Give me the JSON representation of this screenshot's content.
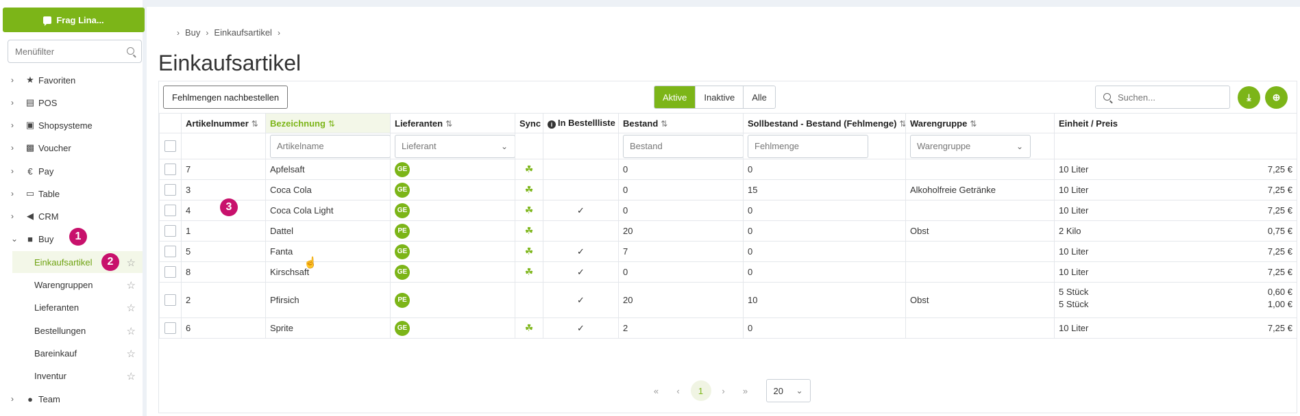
{
  "sidebar": {
    "ask_button": "Frag Lina...",
    "filter_placeholder": "Menüfilter",
    "items": [
      {
        "label": "Favoriten",
        "icon": "star-icon"
      },
      {
        "label": "POS",
        "icon": "cash-register-icon"
      },
      {
        "label": "Shopsysteme",
        "icon": "shopping-cart-icon"
      },
      {
        "label": "Voucher",
        "icon": "gift-icon"
      },
      {
        "label": "Pay",
        "icon": "euro-icon"
      },
      {
        "label": "Table",
        "icon": "book-icon"
      },
      {
        "label": "CRM",
        "icon": "megaphone-icon"
      },
      {
        "label": "Buy",
        "icon": "truck-icon"
      },
      {
        "label": "Team",
        "icon": "users-icon"
      }
    ],
    "buy_children": [
      "Einkaufsartikel",
      "Warengruppen",
      "Lieferanten",
      "Bestellungen",
      "Bareinkauf",
      "Inventur"
    ],
    "badges": [
      "1",
      "2",
      "3"
    ]
  },
  "breadcrumb": [
    "Buy",
    "Einkaufsartikel"
  ],
  "page_title": "Einkaufsartikel",
  "toolbar": {
    "reorder_button": "Fehlmengen nachbestellen",
    "filters": [
      "Aktive",
      "Inaktive",
      "Alle"
    ],
    "search_placeholder": "Suchen..."
  },
  "table": {
    "headers": [
      "Artikelnummer",
      "Bezeichnung",
      "Lieferanten",
      "Sync",
      "In Bestellliste",
      "Bestand",
      "Sollbestand - Bestand (Fehlmenge)",
      "Warengruppe",
      "Einheit / Preis"
    ],
    "filter_placeholders": {
      "name": "Artikelname",
      "supplier": "Lieferant",
      "stock": "Bestand",
      "shortage": "Fehlmenge",
      "group": "Warengruppe"
    },
    "rows": [
      {
        "num": "7",
        "name": "Apfelsaft",
        "supplier": "GE",
        "sync": true,
        "order_list": false,
        "stock": "0",
        "shortage": "0",
        "group": "",
        "units": [
          {
            "u": "10 Liter",
            "p": "7,25 €"
          }
        ]
      },
      {
        "num": "3",
        "name": "Coca Cola",
        "supplier": "GE",
        "sync": true,
        "order_list": false,
        "stock": "0",
        "shortage": "15",
        "group": "Alkoholfreie Getränke",
        "units": [
          {
            "u": "10 Liter",
            "p": "7,25 €"
          }
        ]
      },
      {
        "num": "4",
        "name": "Coca Cola Light",
        "supplier": "GE",
        "sync": true,
        "order_list": true,
        "stock": "0",
        "shortage": "0",
        "group": "",
        "units": [
          {
            "u": "10 Liter",
            "p": "7,25 €"
          }
        ]
      },
      {
        "num": "1",
        "name": "Dattel",
        "supplier": "PE",
        "sync": true,
        "order_list": false,
        "stock": "20",
        "shortage": "0",
        "group": "Obst",
        "units": [
          {
            "u": "2 Kilo",
            "p": "0,75 €"
          }
        ]
      },
      {
        "num": "5",
        "name": "Fanta",
        "supplier": "GE",
        "sync": true,
        "order_list": true,
        "stock": "7",
        "shortage": "0",
        "group": "",
        "units": [
          {
            "u": "10 Liter",
            "p": "7,25 €"
          }
        ]
      },
      {
        "num": "8",
        "name": "Kirschsaft",
        "supplier": "GE",
        "sync": true,
        "order_list": true,
        "stock": "0",
        "shortage": "0",
        "group": "",
        "units": [
          {
            "u": "10 Liter",
            "p": "7,25 €"
          }
        ]
      },
      {
        "num": "2",
        "name": "Pfirsich",
        "supplier": "PE",
        "sync": false,
        "order_list": true,
        "stock": "20",
        "shortage": "10",
        "group": "Obst",
        "units": [
          {
            "u": "5 Stück",
            "p": "0,60 €"
          },
          {
            "u": "5 Stück",
            "p": "1,00 €"
          }
        ]
      },
      {
        "num": "6",
        "name": "Sprite",
        "supplier": "GE",
        "sync": true,
        "order_list": true,
        "stock": "2",
        "shortage": "0",
        "group": "",
        "units": [
          {
            "u": "10 Liter",
            "p": "7,25 €"
          }
        ]
      }
    ]
  },
  "pagination": {
    "current": "1",
    "page_size": "20"
  },
  "colors": {
    "accent": "#7cb518",
    "badge": "#c8116c"
  }
}
